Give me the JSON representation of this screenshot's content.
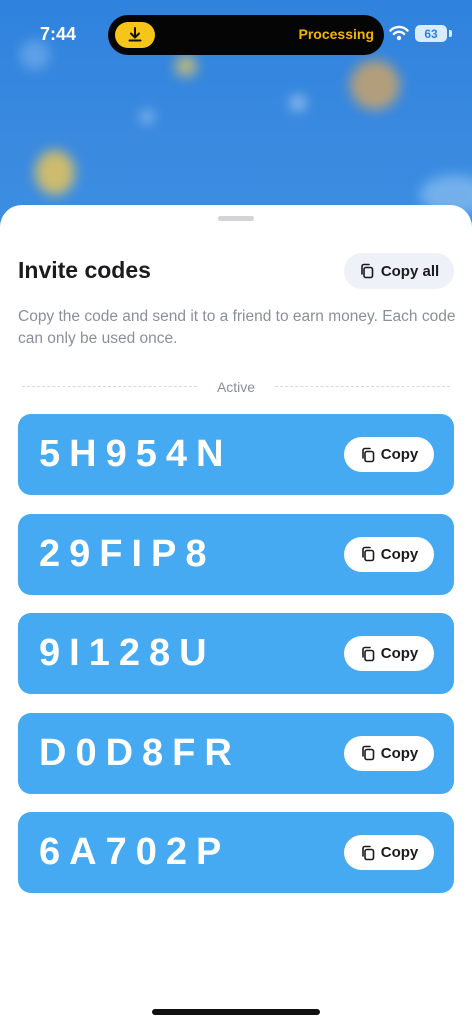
{
  "status_bar": {
    "time": "7:44",
    "activity_label": "Processing",
    "battery_level": "63",
    "icons": [
      "download-icon",
      "wifi-icon",
      "battery-icon"
    ]
  },
  "sheet": {
    "title": "Invite codes",
    "copy_all_label": "Copy all",
    "description": "Copy the code and send it to a friend to earn money. Each code can only be used once.",
    "section_label": "Active",
    "codes": [
      {
        "code": "5H954N",
        "copy_label": "Copy"
      },
      {
        "code": "29FIP8",
        "copy_label": "Copy"
      },
      {
        "code": "9I128U",
        "copy_label": "Copy"
      },
      {
        "code": "D0D8FR",
        "copy_label": "Copy"
      },
      {
        "code": "6A702P",
        "copy_label": "Copy"
      }
    ]
  },
  "colors": {
    "card_blue": "#45aaf2",
    "background_blue": "#2f82dd",
    "accent_yellow": "#f5c518",
    "text_dark": "#1b1b1f",
    "text_muted": "#8a8f99"
  }
}
